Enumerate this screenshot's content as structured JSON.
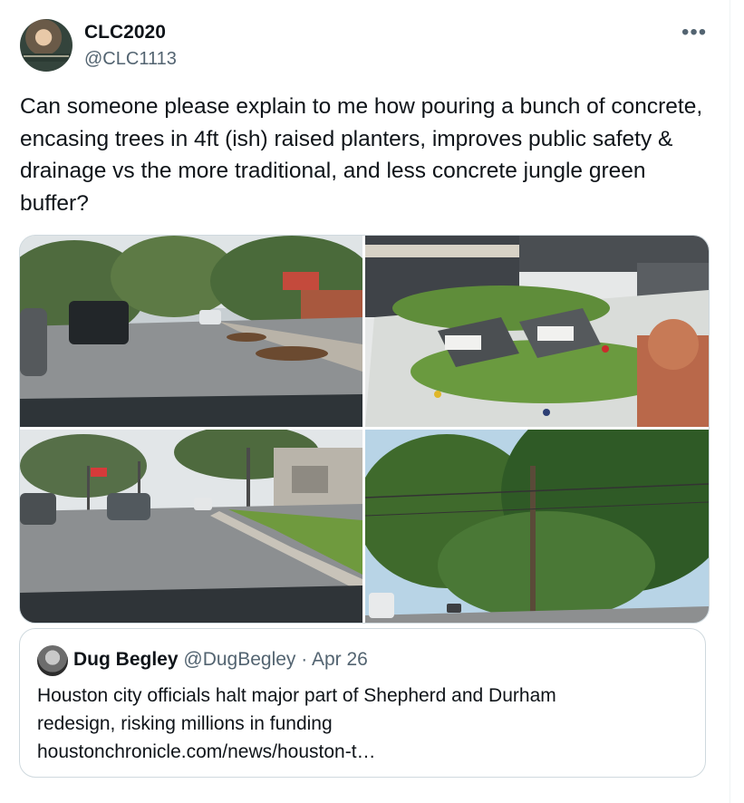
{
  "tweet": {
    "author": {
      "display_name": "CLC2020",
      "handle": "@CLC1113",
      "avatar_icon": "profile-photo"
    },
    "more_menu_glyph": "•••",
    "text": "Can someone please explain to me how pouring a bunch of concrete, encasing trees in 4ft (ish) raised planters, improves public safety & drainage vs the more traditional, and less concrete jungle green buffer?",
    "media": [
      {
        "kind": "photo",
        "subject": "street-with-raised-planters"
      },
      {
        "kind": "render",
        "subject": "architectural-model"
      },
      {
        "kind": "photo",
        "subject": "street-with-green-buffer"
      },
      {
        "kind": "photo",
        "subject": "tree-lined-street"
      }
    ]
  },
  "quoted_tweet": {
    "display_name": "Dug Begley",
    "handle": "@DugBegley",
    "separator": "·",
    "date": "Apr 26",
    "text_lines": [
      "Houston city officials halt major part of Shepherd and Durham",
      "redesign, risking millions in funding",
      "houstonchronicle.com/news/houston-t…"
    ]
  },
  "colors": {
    "text": "#0f1419",
    "secondary": "#536471",
    "border": "#cfd9de"
  }
}
